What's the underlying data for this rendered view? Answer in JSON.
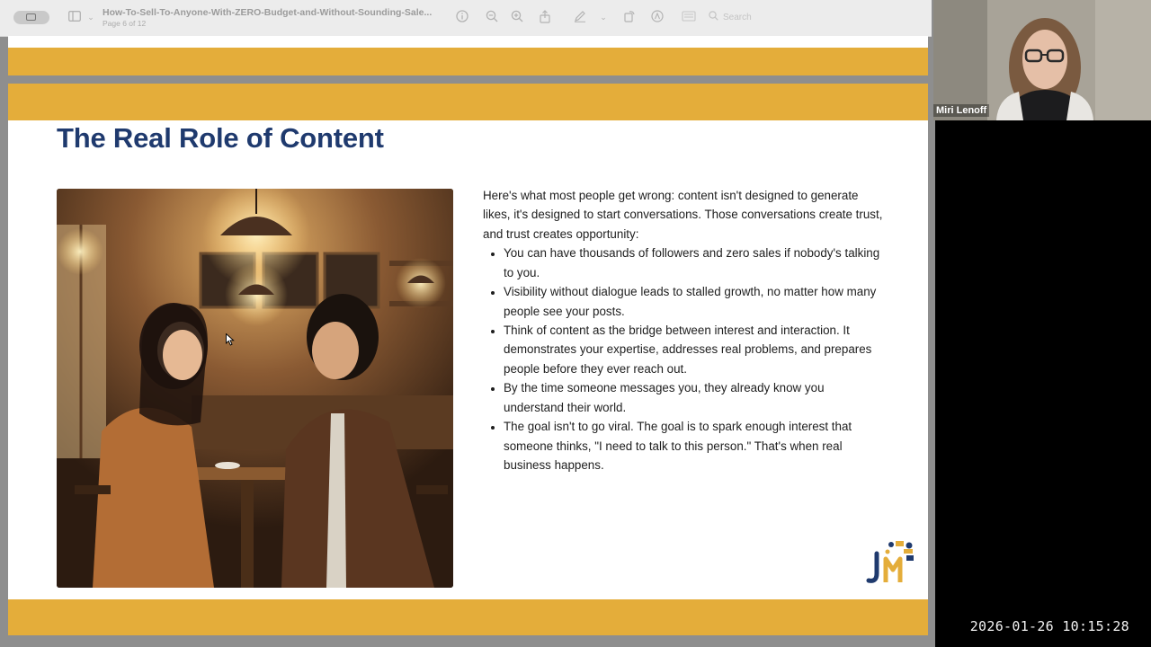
{
  "viewer": {
    "document_title": "How-To-Sell-To-Anyone-With-ZERO-Budget-and-Without-Sounding-Sale...",
    "page_indicator": "Page 6 of 12",
    "search_placeholder": "Search",
    "icons": [
      "sidebar-toggle-icon",
      "chevron-down-icon",
      "info-icon",
      "zoom-out-icon",
      "zoom-in-icon",
      "share-icon",
      "highlight-pen-icon",
      "rotate-icon",
      "markup-icon",
      "redact-icon",
      "search-icon"
    ]
  },
  "slide": {
    "title": "The Real Role of Content",
    "intro": "Here's what most people get wrong: content isn't designed to generate likes, it's designed to start conversations. Those conversations create trust, and trust creates opportunity:",
    "bullets": [
      "You can have thousands of followers and zero sales if nobody's talking to you.",
      "Visibility without dialogue leads to stalled growth, no matter how many people see your posts.",
      "Think of content as the bridge between interest and interaction. It demonstrates your expertise, addresses real problems, and prepares people before they ever reach out.",
      "By the time someone messages you, they already know you understand their world.",
      "The goal isn't to go viral. The goal is to spark enough interest that someone thinks, \"I need to talk to this person.\" That's when real business happens."
    ],
    "accent_color": "#e4ad3a",
    "title_color": "#1f3a6e"
  },
  "video": {
    "participant_name": "Miri Lenoff"
  },
  "clock": "2026-01-26  10:15:28"
}
